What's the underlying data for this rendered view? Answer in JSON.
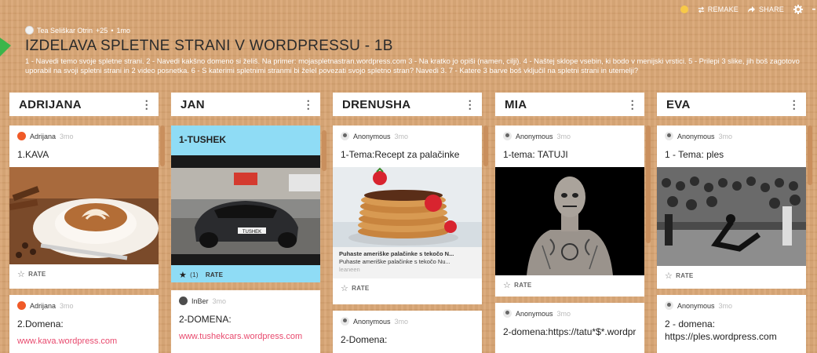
{
  "toolbar": {
    "remake_label": "REMAKE",
    "share_label": "SHARE"
  },
  "board": {
    "author": "Tea Seliškar Otrin",
    "karma": "+25",
    "separator": "•",
    "age": "1mo",
    "title": "IZDELAVA SPLETNE STRANI V WORDPRESSU - 1B",
    "description": "1 - Navedi temo svoje spletne strani. 2 - Navedi kakšno domeno si želiš. Na primer: mojaspletnastran.wordpress.com 3 - Na kratko jo opiši (namen, cilji). 4 - Naštej sklope vsebin, ki bodo v menijski vrstici. 5 - Prilepi 3 slike, jih boš zagotovo uporabil na svoji spletni strani in 2 video posnetka. 6 - S katerimi spletnimi stranmi bi želel povezati svojo spletno stran? Navedi 3. 7 - Katere 3 barve boš vključil na spletni strani in utemelji?"
  },
  "columns": [
    {
      "title": "ADRIJANA",
      "cards": [
        {
          "author": "Adrijana",
          "age": "3mo",
          "title": "1.KAVA",
          "rate": "RATE"
        },
        {
          "author": "Adrijana",
          "age": "3mo",
          "title": "2.Domena:",
          "link": "www.kava.wordpress.com"
        }
      ]
    },
    {
      "title": "JAN",
      "cards": [
        {
          "title": "1-TUSHEK",
          "rate_count": "(1)",
          "rate": "RATE",
          "plate": "TUSHEK"
        },
        {
          "author": "InBer",
          "age": "3mo",
          "title": "2-DOMENA:",
          "link": "www.tushekcars.wordpress.com"
        }
      ]
    },
    {
      "title": "DRENUSHA",
      "cards": [
        {
          "author": "Anonymous",
          "age": "3mo",
          "title": "1-Tema:Recept za palačinke",
          "preview_title": "Puhaste ameriške palačinke s tekočo N...",
          "preview_desc": "Puhaste ameriške palačinke s tekočo Nu...",
          "preview_source": "leaneen",
          "rate": "RATE"
        },
        {
          "author": "Anonymous",
          "age": "3mo",
          "title": "2-Domena:"
        }
      ]
    },
    {
      "title": "MIA",
      "cards": [
        {
          "author": "Anonymous",
          "age": "3mo",
          "title": "1-tema: TATUJI",
          "rate": "RATE"
        },
        {
          "author": "Anonymous",
          "age": "3mo",
          "title": "2-domena:https://tatu*$*.wordpr"
        }
      ]
    },
    {
      "title": "EVA",
      "cards": [
        {
          "author": "Anonymous",
          "age": "3mo",
          "title": "1 - Tema: ples",
          "rate": "RATE"
        },
        {
          "author": "Anonymous",
          "age": "3mo",
          "title": "2 - domena: https://ples.wordpress.com"
        }
      ]
    }
  ],
  "colors": {
    "background": "#d9a574",
    "link": "#e84a6e",
    "highlight_card": "#8fdcf5",
    "add_post": "#3bb54a"
  },
  "icons": {
    "remake": "remake-icon",
    "share": "share-icon",
    "settings": "gear-icon",
    "rate": "star-icon",
    "more": "kebab-icon"
  }
}
